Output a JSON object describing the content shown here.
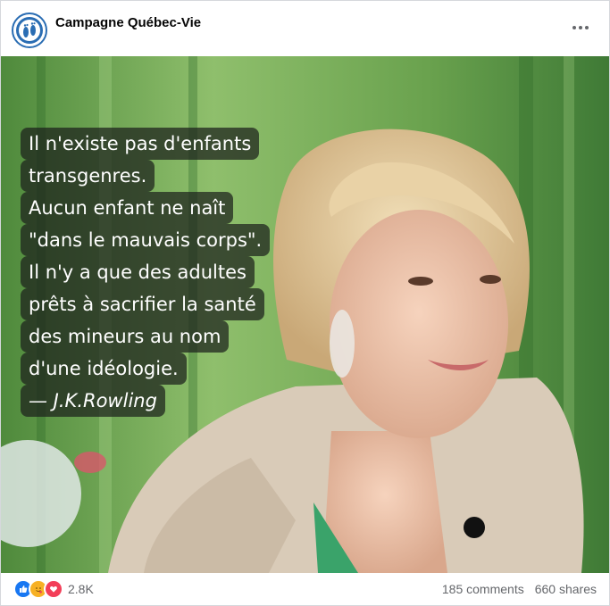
{
  "post": {
    "page_name": "Campagne Québec-Vie",
    "more_icon": "more-options-icon",
    "avatar_icon": "feet-logo-icon"
  },
  "image": {
    "quote_lines": [
      "Il n'existe pas d'enfants",
      "transgenres.",
      "Aucun enfant ne naît",
      "\"dans le mauvais corps\".",
      "Il n'y a que des adultes",
      "prêts à sacrifier la santé",
      "des mineurs au nom",
      "d'une idéologie."
    ],
    "author": "— J.K.Rowling"
  },
  "footer": {
    "reaction_icons": [
      "like-icon",
      "care-icon",
      "love-icon"
    ],
    "reaction_count": "2.8K",
    "comments": "185 comments",
    "shares": "660 shares"
  },
  "colors": {
    "brand_blue": "#1877f2",
    "love_red": "#f33e58",
    "care_yellow": "#f7b125"
  }
}
